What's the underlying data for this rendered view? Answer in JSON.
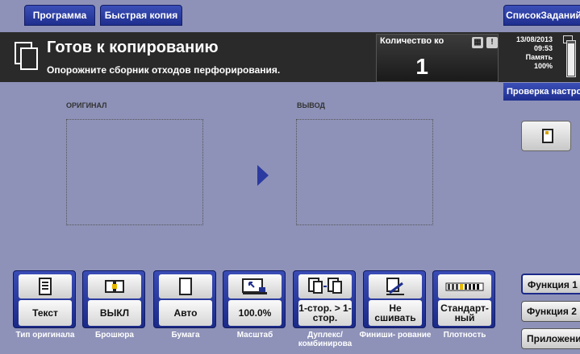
{
  "tabs": {
    "program": "Программа",
    "quick_copy": "Быстрая копия",
    "job_list": "СписокЗаданий"
  },
  "status": {
    "title": "Готов к копированию",
    "message": "Опорожните сборник отходов перфорирования."
  },
  "copies": {
    "label": "Количество ко",
    "value": "1"
  },
  "info": {
    "date": "13/08/2013",
    "time": "09:53",
    "memory_label": "Память",
    "memory_value": "100%",
    "check_settings": "Проверка настро"
  },
  "preview": {
    "original_label": "ОРИГИНАЛ",
    "output_label": "ВЫВОД"
  },
  "functions": [
    {
      "value": "Текст",
      "caption": "Тип оригинала",
      "icon": "text-document-icon"
    },
    {
      "value": "ВЫКЛ",
      "caption": "Брошюра",
      "icon": "booklet-icon"
    },
    {
      "value": "Авто",
      "caption": "Бумага",
      "icon": "paper-icon"
    },
    {
      "value": "100.0%",
      "caption": "Масштаб",
      "icon": "zoom-icon"
    },
    {
      "value": "1-стор. > 1-стор.",
      "caption": "Дуплекс/ комбинирова",
      "icon": "duplex-icon"
    },
    {
      "value": "Не сшивать",
      "caption": "Финиши- рование",
      "icon": "finishing-icon"
    },
    {
      "value": "Стандарт- ный",
      "caption": "Плотность",
      "icon": "density-icon"
    }
  ],
  "right_menu": {
    "function1": "Функция 1",
    "function2": "Функция 2",
    "application": "Приложение"
  },
  "colors": {
    "accent": "#1f2f8f",
    "background": "#8e92b8",
    "status_bar": "#2a2a2a"
  }
}
